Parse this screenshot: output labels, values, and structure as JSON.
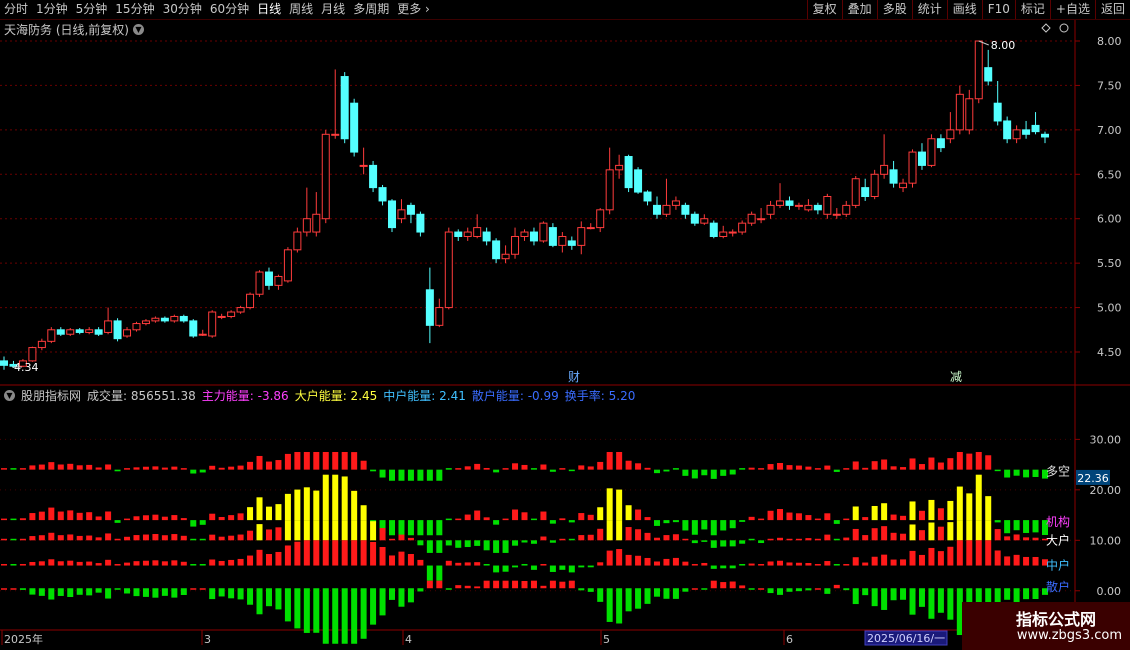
{
  "toolbar": {
    "periods": [
      "分时",
      "1分钟",
      "5分钟",
      "15分钟",
      "30分钟",
      "60分钟",
      "日线",
      "周线",
      "月线",
      "多周期",
      "更多"
    ],
    "active": "日线",
    "right_buttons": [
      "复权",
      "叠加",
      "多股",
      "统计",
      "画线",
      "F10",
      "标记",
      "+自选",
      "返回"
    ]
  },
  "main": {
    "title": "天海防务 (日线,前复权)",
    "high_label": "8.00",
    "low_label": "4.34",
    "markers": [
      "财",
      "减"
    ],
    "y_ticks": [
      "8.00",
      "7.50",
      "7.00",
      "6.50",
      "6.00",
      "5.50",
      "5.00",
      "4.50"
    ]
  },
  "indicator": {
    "name": "股朋指标网",
    "items": [
      {
        "label": "成交量: 856551.38",
        "color": "#c8c8c8"
      },
      {
        "label": "主力能量: -3.86",
        "color": "#ff40ff"
      },
      {
        "label": "大户能量: 2.45",
        "color": "#ffff40"
      },
      {
        "label": "中户能量: 2.41",
        "color": "#40c0ff"
      },
      {
        "label": "散户能量: -0.99",
        "color": "#3a6cff"
      },
      {
        "label": "换手率: 5.20",
        "color": "#3a6cff"
      }
    ],
    "y_ticks": [
      "30.00",
      "20.00",
      "10.00",
      "0.00"
    ],
    "current_value": "22.36",
    "row_labels": [
      {
        "text": "多空",
        "color": "#e0e0e0"
      },
      {
        "text": "机构",
        "color": "#ff40ff"
      },
      {
        "text": "大户",
        "color": "#ffffff"
      },
      {
        "text": "中户",
        "color": "#40c0ff"
      },
      {
        "text": "散户",
        "color": "#3a6cff"
      }
    ]
  },
  "x_axis": {
    "labels": [
      "2025年",
      "3",
      "4",
      "5",
      "6"
    ],
    "date_box": "2025/06/16/一"
  },
  "watermark": {
    "line1": "指标公式网",
    "line2": "www.zbgs3.com"
  },
  "colors": {
    "up": "#ff3c3c",
    "down": "#54ffff",
    "green": "#00e000",
    "yellow": "#ffff00",
    "red": "#ff1a1a",
    "axis": "#8b0000"
  },
  "chart_data": {
    "type": "candlestick",
    "series": [
      {
        "name": "candles",
        "values": [
          [
            4.4,
            4.35,
            4.45,
            4.3
          ],
          [
            4.36,
            4.34,
            4.4,
            4.32
          ],
          [
            4.34,
            4.4,
            4.42,
            4.33
          ],
          [
            4.4,
            4.55,
            4.56,
            4.39
          ],
          [
            4.55,
            4.62,
            4.65,
            4.52
          ],
          [
            4.62,
            4.75,
            4.78,
            4.6
          ],
          [
            4.75,
            4.7,
            4.78,
            4.68
          ],
          [
            4.7,
            4.75,
            4.77,
            4.68
          ],
          [
            4.75,
            4.72,
            4.77,
            4.7
          ],
          [
            4.72,
            4.75,
            4.78,
            4.7
          ],
          [
            4.75,
            4.7,
            4.78,
            4.68
          ],
          [
            4.72,
            4.85,
            5.0,
            4.7
          ],
          [
            4.85,
            4.65,
            4.88,
            4.62
          ],
          [
            4.68,
            4.75,
            4.78,
            4.66
          ],
          [
            4.75,
            4.82,
            4.84,
            4.73
          ],
          [
            4.82,
            4.85,
            4.87,
            4.8
          ],
          [
            4.85,
            4.88,
            4.9,
            4.83
          ],
          [
            4.88,
            4.85,
            4.9,
            4.83
          ],
          [
            4.85,
            4.9,
            4.92,
            4.83
          ],
          [
            4.9,
            4.85,
            4.92,
            4.83
          ],
          [
            4.85,
            4.68,
            4.87,
            4.66
          ],
          [
            4.7,
            4.7,
            4.75,
            4.68
          ],
          [
            4.68,
            4.95,
            4.97,
            4.66
          ],
          [
            4.9,
            4.9,
            4.93,
            4.87
          ],
          [
            4.9,
            4.95,
            4.97,
            4.88
          ],
          [
            4.95,
            5.0,
            5.02,
            4.93
          ],
          [
            5.0,
            5.15,
            5.17,
            4.98
          ],
          [
            5.15,
            5.4,
            5.42,
            5.12
          ],
          [
            5.4,
            5.25,
            5.45,
            5.2
          ],
          [
            5.25,
            5.35,
            5.37,
            5.2
          ],
          [
            5.3,
            5.65,
            5.68,
            5.28
          ],
          [
            5.65,
            5.85,
            5.9,
            5.62
          ],
          [
            5.85,
            6.0,
            6.35,
            5.8
          ],
          [
            5.85,
            6.05,
            6.3,
            5.8
          ],
          [
            6.0,
            6.95,
            7.0,
            5.95
          ],
          [
            6.95,
            6.95,
            7.68,
            6.9
          ],
          [
            7.6,
            6.9,
            7.65,
            6.85
          ],
          [
            7.3,
            6.75,
            7.35,
            6.7
          ],
          [
            6.6,
            6.6,
            6.8,
            6.5
          ],
          [
            6.6,
            6.35,
            6.65,
            6.3
          ],
          [
            6.35,
            6.2,
            6.38,
            6.15
          ],
          [
            6.2,
            5.9,
            6.22,
            5.85
          ],
          [
            6.0,
            6.1,
            6.22,
            5.95
          ],
          [
            6.15,
            6.05,
            6.18,
            5.95
          ],
          [
            6.05,
            5.85,
            6.08,
            5.8
          ],
          [
            5.2,
            4.8,
            5.45,
            4.6
          ],
          [
            4.8,
            5.0,
            5.1,
            4.78
          ],
          [
            5.0,
            5.85,
            5.9,
            4.98
          ],
          [
            5.85,
            5.8,
            5.88,
            5.75
          ],
          [
            5.8,
            5.85,
            5.9,
            5.75
          ],
          [
            5.8,
            5.9,
            6.05,
            5.78
          ],
          [
            5.85,
            5.75,
            5.9,
            5.7
          ],
          [
            5.75,
            5.55,
            5.78,
            5.5
          ],
          [
            5.55,
            5.6,
            5.7,
            5.5
          ],
          [
            5.6,
            5.8,
            5.9,
            5.55
          ],
          [
            5.8,
            5.85,
            5.88,
            5.75
          ],
          [
            5.85,
            5.75,
            5.9,
            5.7
          ],
          [
            5.75,
            5.95,
            5.97,
            5.73
          ],
          [
            5.9,
            5.7,
            5.95,
            5.68
          ],
          [
            5.7,
            5.8,
            5.85,
            5.62
          ],
          [
            5.75,
            5.7,
            5.8,
            5.65
          ],
          [
            5.7,
            5.9,
            5.97,
            5.6
          ],
          [
            5.9,
            5.9,
            5.95,
            5.88
          ],
          [
            5.9,
            6.1,
            6.12,
            5.85
          ],
          [
            6.1,
            6.55,
            6.8,
            6.05
          ],
          [
            6.55,
            6.6,
            6.72,
            6.45
          ],
          [
            6.7,
            6.35,
            6.72,
            6.3
          ],
          [
            6.55,
            6.3,
            6.58,
            6.28
          ],
          [
            6.3,
            6.2,
            6.32,
            6.15
          ],
          [
            6.15,
            6.05,
            6.25,
            6.0
          ],
          [
            6.05,
            6.15,
            6.45,
            6.02
          ],
          [
            6.15,
            6.2,
            6.25,
            6.1
          ],
          [
            6.15,
            6.05,
            6.18,
            6.0
          ],
          [
            6.05,
            5.95,
            6.08,
            5.92
          ],
          [
            5.95,
            6.0,
            6.05,
            5.93
          ],
          [
            5.95,
            5.8,
            5.98,
            5.78
          ],
          [
            5.8,
            5.85,
            5.92,
            5.78
          ],
          [
            5.85,
            5.85,
            5.88,
            5.8
          ],
          [
            5.85,
            5.95,
            5.98,
            5.82
          ],
          [
            5.95,
            6.05,
            6.08,
            5.92
          ],
          [
            6.0,
            6.0,
            6.12,
            5.95
          ],
          [
            6.05,
            6.15,
            6.2,
            6.0
          ],
          [
            6.15,
            6.2,
            6.4,
            6.12
          ],
          [
            6.2,
            6.15,
            6.25,
            6.1
          ],
          [
            6.15,
            6.15,
            6.18,
            6.1
          ],
          [
            6.1,
            6.15,
            6.22,
            6.08
          ],
          [
            6.15,
            6.1,
            6.18,
            6.05
          ],
          [
            6.05,
            6.25,
            6.28,
            6.0
          ],
          [
            6.05,
            6.05,
            6.12,
            6.0
          ],
          [
            6.05,
            6.15,
            6.2,
            6.02
          ],
          [
            6.15,
            6.45,
            6.48,
            6.12
          ],
          [
            6.35,
            6.25,
            6.45,
            6.2
          ],
          [
            6.25,
            6.5,
            6.55,
            6.22
          ],
          [
            6.5,
            6.6,
            6.95,
            6.45
          ],
          [
            6.55,
            6.4,
            6.65,
            6.35
          ],
          [
            6.35,
            6.4,
            6.45,
            6.3
          ],
          [
            6.4,
            6.75,
            6.78,
            6.35
          ],
          [
            6.75,
            6.6,
            6.85,
            6.55
          ],
          [
            6.6,
            6.9,
            6.95,
            6.58
          ],
          [
            6.9,
            6.8,
            6.95,
            6.75
          ],
          [
            6.9,
            7.0,
            7.2,
            6.85
          ],
          [
            7.0,
            7.4,
            7.5,
            6.95
          ],
          [
            7.0,
            7.35,
            7.45,
            6.95
          ],
          [
            7.35,
            8.0,
            8.0,
            7.3
          ],
          [
            7.7,
            7.55,
            7.9,
            7.5
          ],
          [
            7.3,
            7.1,
            7.55,
            7.05
          ],
          [
            7.1,
            6.9,
            7.15,
            6.85
          ],
          [
            6.9,
            7.0,
            7.05,
            6.85
          ],
          [
            7.0,
            6.95,
            7.1,
            6.9
          ],
          [
            7.05,
            6.98,
            7.2,
            6.95
          ],
          [
            6.95,
            6.92,
            6.98,
            6.85
          ]
        ]
      }
    ]
  }
}
